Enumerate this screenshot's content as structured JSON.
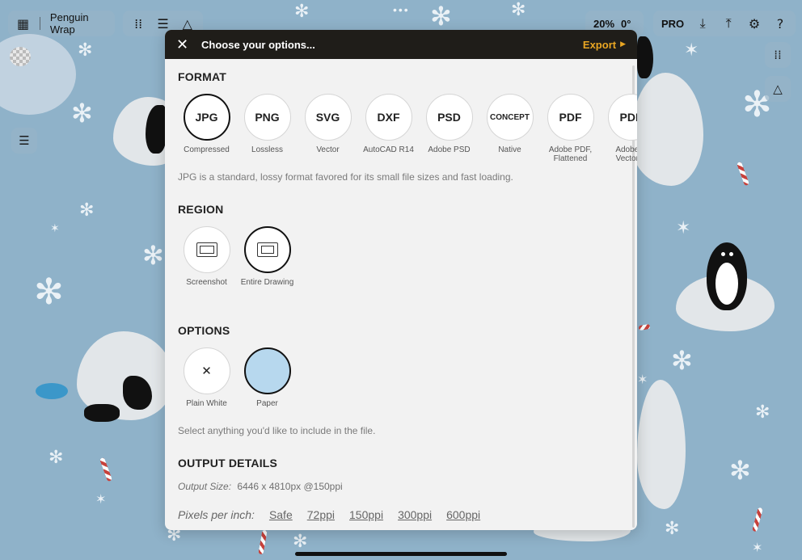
{
  "app": {
    "project_title": "Penguin Wrap",
    "zoom": "20%",
    "rotation": "0°",
    "pro_label": "PRO"
  },
  "icons": {
    "gallery": "grid-icon",
    "brushes": "dots-grid-icon",
    "layers": "layers-icon",
    "shapes": "shapes-icon",
    "rotate": "rotate-icon",
    "import": "download-icon",
    "share": "upload-icon",
    "settings": "gear-icon",
    "help": "question-icon"
  },
  "modal": {
    "title": "Choose your options...",
    "close_label": "✕",
    "export_label": "Export",
    "format": {
      "title": "FORMAT",
      "items": [
        {
          "name": "JPG",
          "caption": "Compressed",
          "selected": true
        },
        {
          "name": "PNG",
          "caption": "Lossless"
        },
        {
          "name": "SVG",
          "caption": "Vector"
        },
        {
          "name": "DXF",
          "caption": "AutoCAD R14"
        },
        {
          "name": "PSD",
          "caption": "Adobe PSD"
        },
        {
          "name": "CONCEPT",
          "caption": "Native"
        },
        {
          "name": "PDF",
          "caption": "Adobe PDF,",
          "caption2": "Flattened"
        },
        {
          "name": "PDF",
          "caption": "Adobe P",
          "caption2": "Vector P"
        }
      ],
      "description": "JPG is a standard, lossy format favored for its small file sizes and fast loading."
    },
    "region": {
      "title": "REGION",
      "items": [
        {
          "caption": "Screenshot",
          "icon": "screen-icon"
        },
        {
          "caption": "Entire Drawing",
          "icon": "drawing-icon",
          "selected": true
        }
      ]
    },
    "options": {
      "title": "OPTIONS",
      "items": [
        {
          "caption": "Plain White",
          "icon": "x-icon"
        },
        {
          "caption": "Paper",
          "selected": true
        }
      ],
      "description": "Select anything you'd like to include in the file."
    },
    "output": {
      "title": "OUTPUT DETAILS",
      "size_label": "Output Size:",
      "size_value": "6446 x 4810px @150ppi",
      "ppi_label": "Pixels per inch:",
      "ppi_options": [
        "Safe",
        "72ppi",
        "150ppi",
        "300ppi",
        "600ppi"
      ]
    }
  },
  "colors": {
    "accent": "#e9a623",
    "header_bg": "#1f1d19",
    "canvas_bg": "#8fb2c9",
    "paper": "#b7d8ee"
  }
}
